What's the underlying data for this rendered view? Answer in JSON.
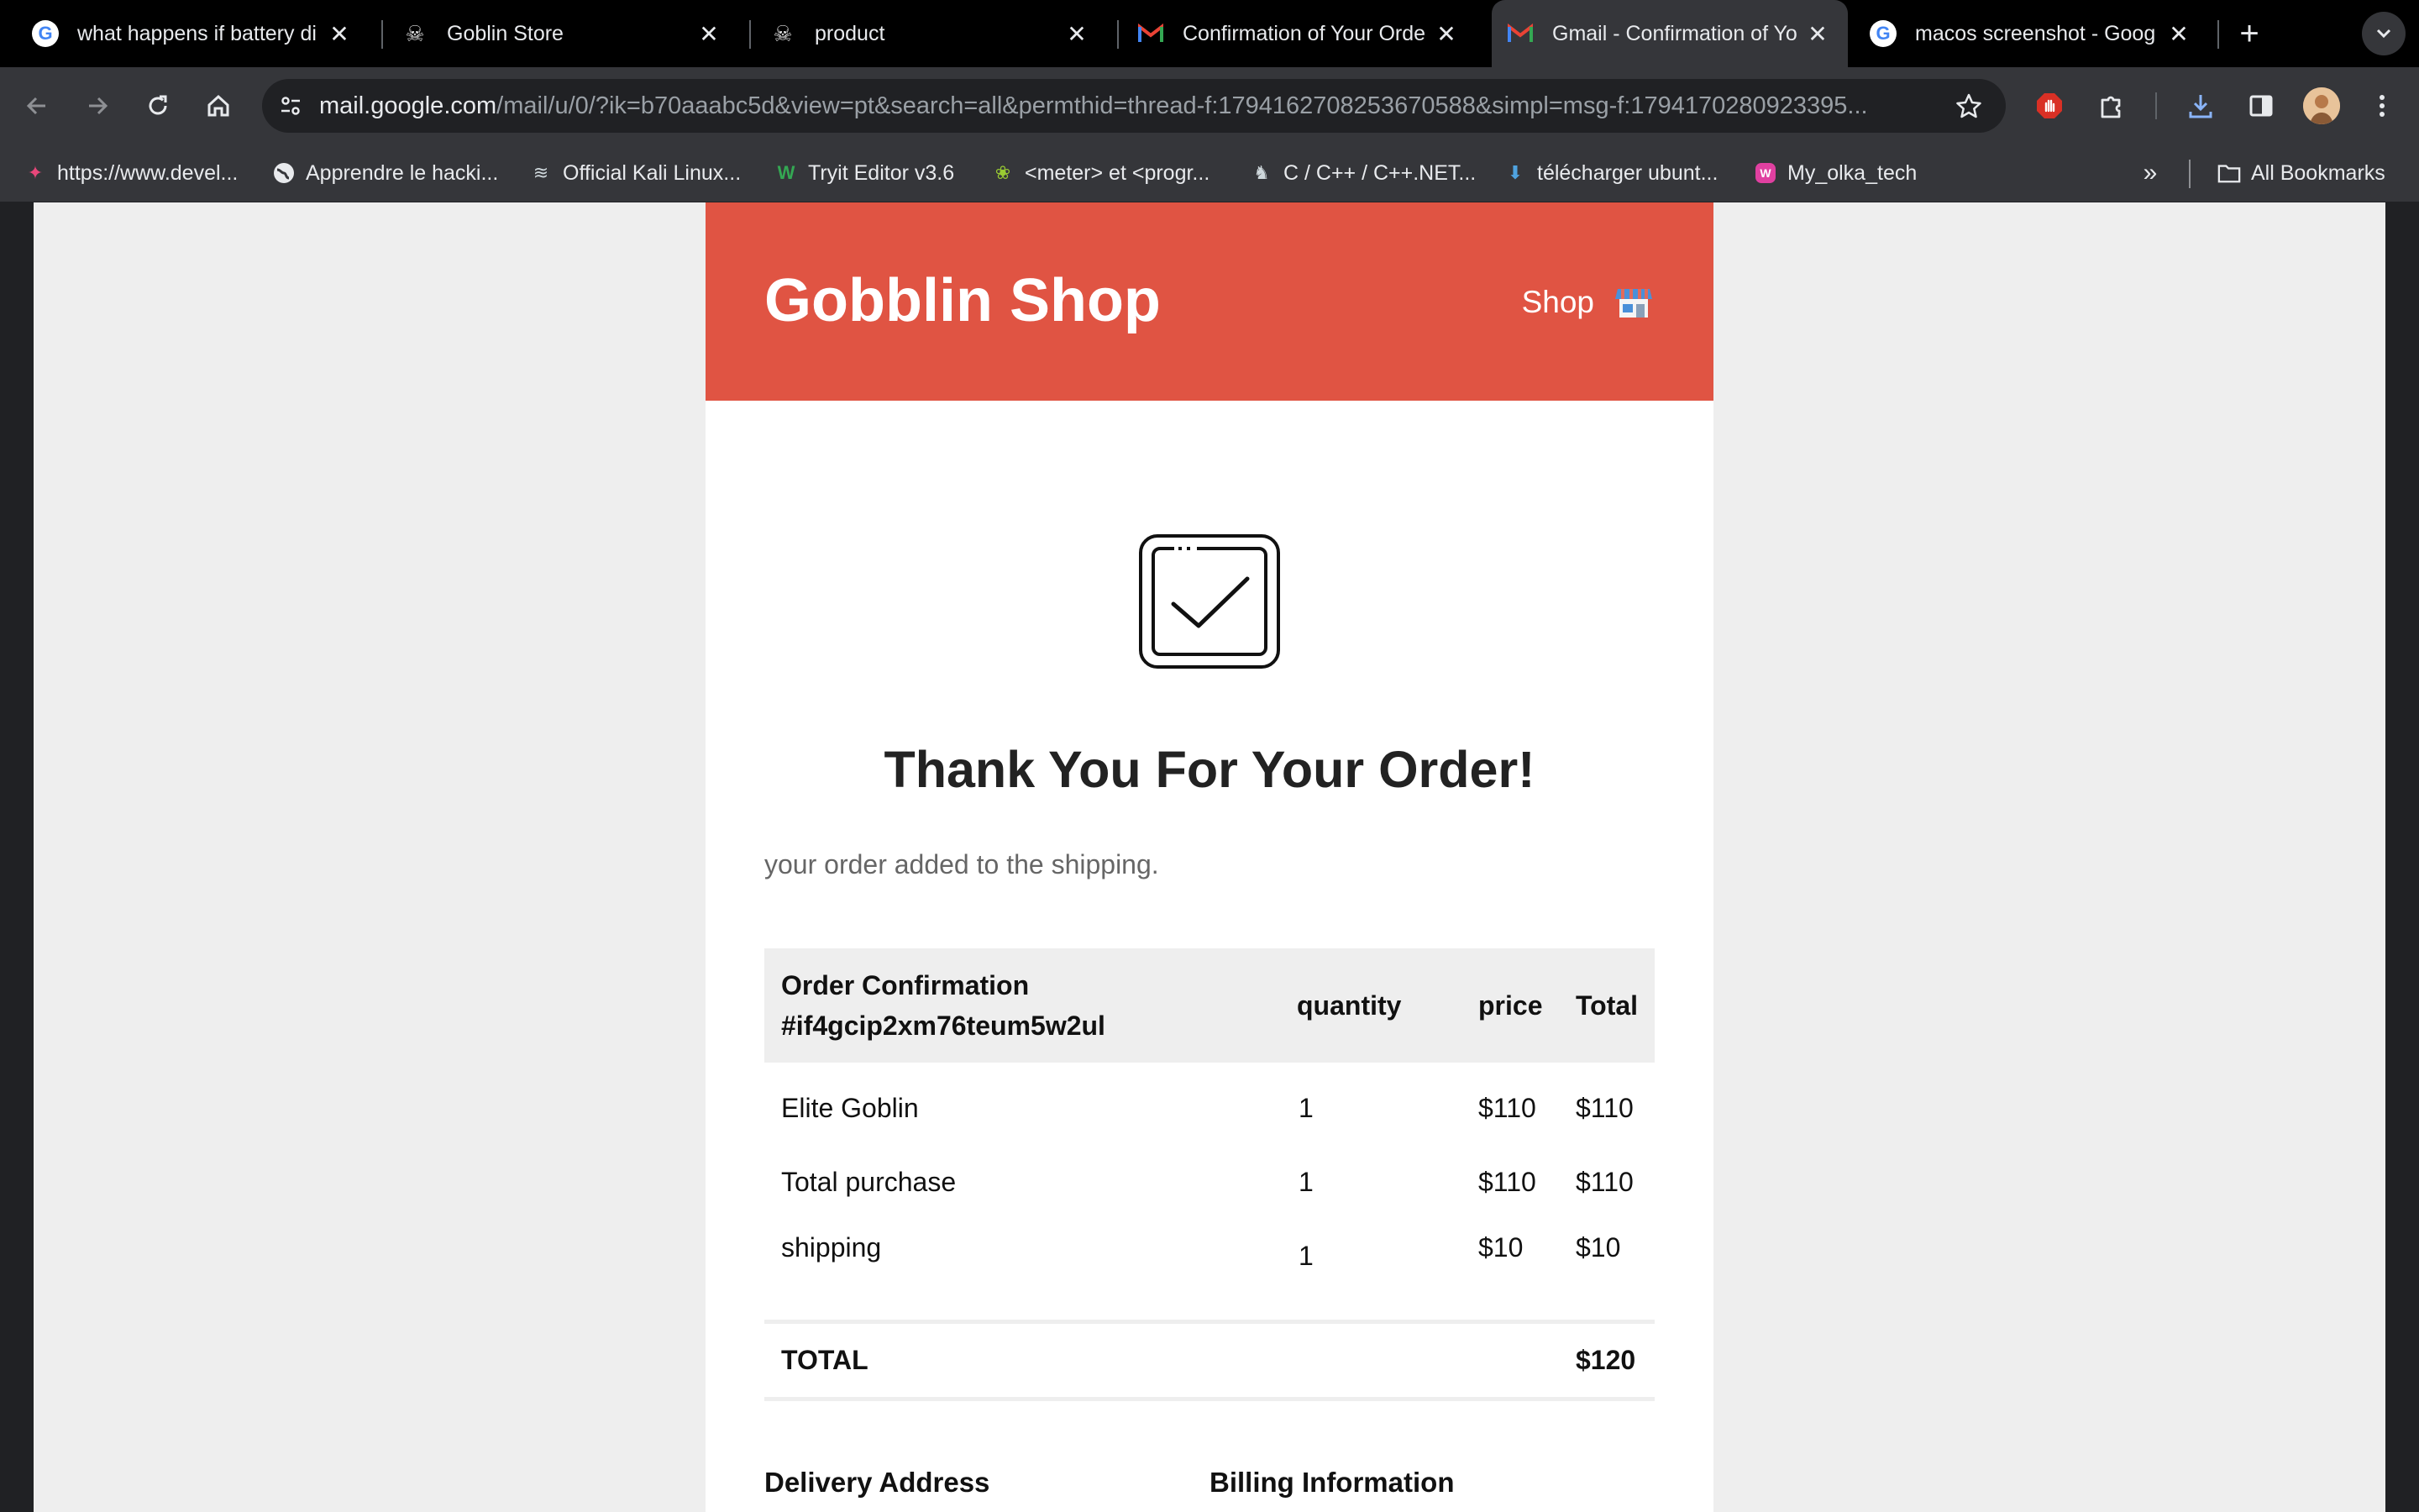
{
  "browser": {
    "tabs": [
      {
        "title": "what happens if battery di",
        "icon": "google-icon"
      },
      {
        "title": "Goblin Store",
        "icon": "goblin-icon"
      },
      {
        "title": "product",
        "icon": "goblin-icon"
      },
      {
        "title": "Confirmation of Your Orde",
        "icon": "gmail-icon"
      },
      {
        "title": "Gmail - Confirmation of Yo",
        "icon": "gmail-icon",
        "active": true
      },
      {
        "title": "macos screenshot - Goog",
        "icon": "google-icon"
      }
    ],
    "url_host": "mail.google.com",
    "url_path": "/mail/u/0/?ik=b70aaabc5d&view=pt&search=all&permthid=thread-f:1794162708253670588&simpl=msg-f:1794170280923395...",
    "bookmarks": [
      {
        "label": "https://www.devel...",
        "icon": "dev-icon"
      },
      {
        "label": "Apprendre le hacki...",
        "icon": "globe-icon"
      },
      {
        "label": "Official Kali Linux...",
        "icon": "kali-icon"
      },
      {
        "label": "Tryit Editor v3.6",
        "icon": "w3-icon"
      },
      {
        "label": "<meter> et <progr...",
        "icon": "mdn-icon"
      },
      {
        "label": "C / C++ / C++.NET...",
        "icon": "dev-icon"
      },
      {
        "label": "télécharger ubunt...",
        "icon": "download-bookmark-icon"
      },
      {
        "label": "My_olka_tech",
        "icon": "olka-icon"
      }
    ],
    "all_bookmarks_label": "All Bookmarks"
  },
  "email": {
    "brand": "Gobblin Shop",
    "shop_link": "Shop",
    "heading": "Thank You For Your Order!",
    "subtitle": "your order added to the shipping.",
    "table": {
      "headers": {
        "order_line1": "Order Confirmation",
        "order_line2": "#if4gcip2xm76teum5w2ul",
        "quantity": "quantity",
        "price": "price",
        "total": "Total"
      },
      "rows": [
        {
          "item": "Elite Goblin",
          "qty": "1",
          "price": "$110",
          "total": "$110"
        },
        {
          "item": "Total purchase",
          "qty": "1",
          "price": "$110",
          "total": "$110"
        },
        {
          "item": "shipping",
          "qty": "1",
          "price": "$10",
          "total": "$10"
        }
      ],
      "total_label": "TOTAL",
      "total_value": "$120"
    },
    "delivery_heading": "Delivery Address",
    "billing_heading": "Billing Information"
  },
  "colors": {
    "brand_red": "#e05443",
    "page_bg": "#eeeeee",
    "chrome_dark": "#35363a"
  }
}
